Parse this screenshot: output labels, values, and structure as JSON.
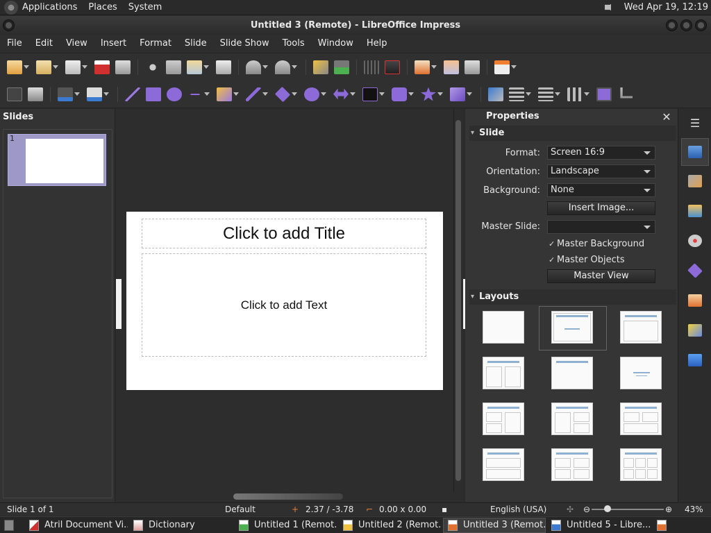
{
  "top_panel": {
    "menus": [
      "Applications",
      "Places",
      "System"
    ],
    "clock": "Wed Apr 19, 12:19"
  },
  "window": {
    "title": "Untitled 3 (Remote) - LibreOffice Impress"
  },
  "menubar": [
    "File",
    "Edit",
    "View",
    "Insert",
    "Format",
    "Slide",
    "Slide Show",
    "Tools",
    "Window",
    "Help"
  ],
  "slides_pane": {
    "title": "Slides",
    "slide_number": "1"
  },
  "slide": {
    "title_placeholder": "Click to add Title",
    "text_placeholder": "Click to add Text"
  },
  "properties": {
    "title": "Properties",
    "close_label": "✕",
    "slide_section": {
      "title": "Slide",
      "format_label": "Format:",
      "format_value": "Screen 16:9",
      "orientation_label": "Orientation:",
      "orientation_value": "Landscape",
      "background_label": "Background:",
      "background_value": "None",
      "insert_image_label": "Insert Image...",
      "master_slide_label": "Master Slide:",
      "master_slide_value": "",
      "master_background_label": "Master Background",
      "master_objects_label": "Master Objects",
      "master_view_label": "Master View"
    },
    "layouts_section": {
      "title": "Layouts"
    }
  },
  "statusbar": {
    "slide_info": "Slide 1 of 1",
    "master": "Default",
    "position": "2.37 / -3.78",
    "size": "0.00 x 0.00",
    "language": "English (USA)",
    "zoom": "43%"
  },
  "taskbar": {
    "tasks": [
      {
        "label": "Atril Document Vi...",
        "active": false
      },
      {
        "label": "Dictionary",
        "active": false
      },
      {
        "label": "Untitled 1 (Remot...",
        "active": false
      },
      {
        "label": "Untitled 2 (Remot...",
        "active": false
      },
      {
        "label": "Untitled 3 (Remot...",
        "active": true
      },
      {
        "label": "Untitled 5 - Libre...",
        "active": false
      }
    ]
  },
  "colors": {
    "accent_thumbnail": "#9d98c6",
    "layout_title_bar": "#8fb0d0",
    "background": "#2b2b2b"
  }
}
